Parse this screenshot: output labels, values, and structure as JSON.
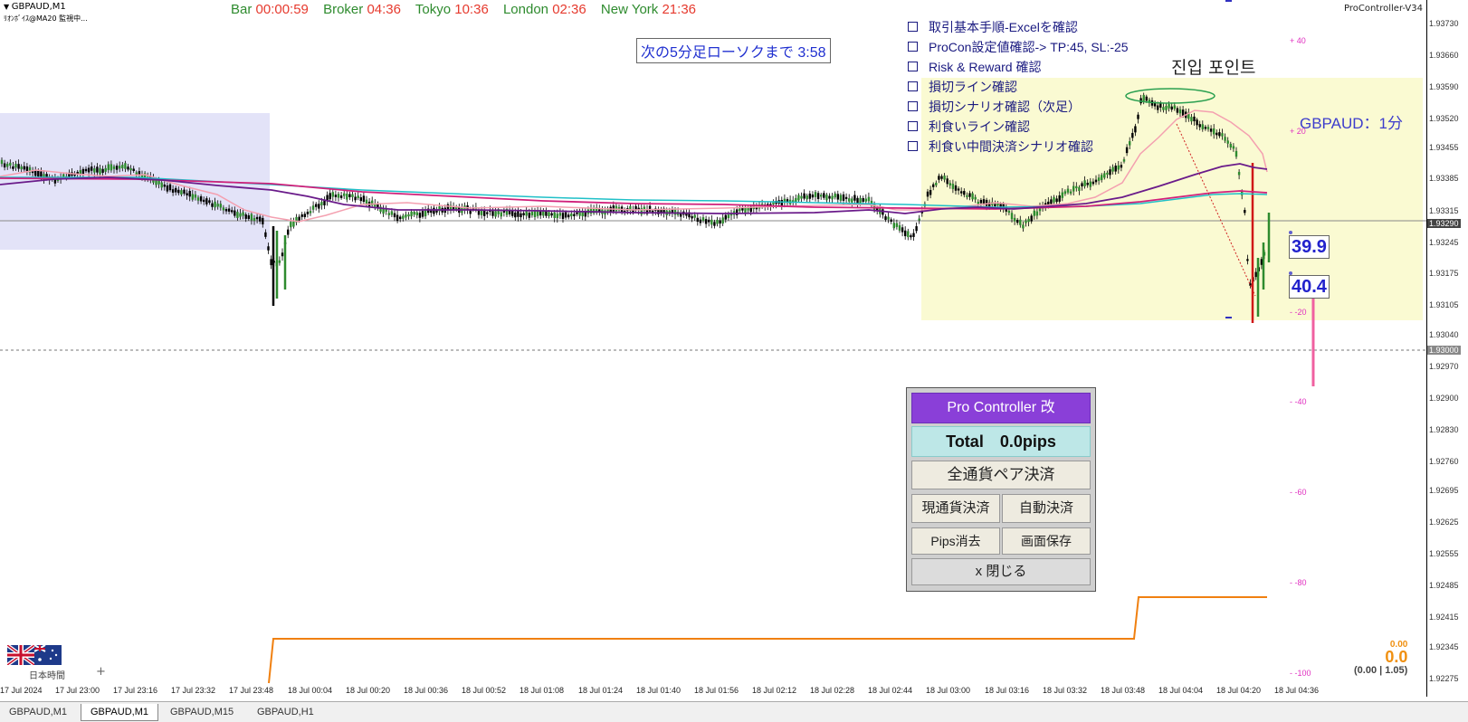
{
  "header": {
    "symbol_tf": "GBPAUD,M1",
    "indicator_sub": "ﾘｵﾝﾎﾞｲｽ@MA20 監視中...",
    "version": "ProController-V34"
  },
  "clocks": [
    {
      "label": "Bar",
      "value": "00:00:59"
    },
    {
      "label": "Broker",
      "value": "04:36"
    },
    {
      "label": "Tokyo",
      "value": "10:36"
    },
    {
      "label": "London",
      "value": "02:36"
    },
    {
      "label": "New York",
      "value": "21:36"
    }
  ],
  "countdown": "次の5分足ローソクまで 3:58",
  "checklist": [
    "取引基本手順-Excelを確認",
    "ProCon設定値確認-> TP:45, SL:-25",
    "Risk & Reward 確認",
    "損切ライン確認",
    "損切シナリオ確認（次足）",
    "利食いライン確認",
    "利食い中間決済シナリオ確認"
  ],
  "entry_label": "진입 포인트",
  "pair_label": "GBPAUD：1分",
  "pips_boxes": {
    "upper": "39.9",
    "lower": "40.4"
  },
  "pink_scale": [
    "40",
    "20",
    "-20",
    "-40",
    "-60",
    "-80",
    "-100"
  ],
  "price_axis": [
    "1.93730",
    "1.93660",
    "1.93590",
    "1.93520",
    "1.93455",
    "1.93385",
    "1.93315",
    "1.93245",
    "1.93175",
    "1.93105",
    "1.93040",
    "1.92970",
    "1.92900",
    "1.92830",
    "1.92760",
    "1.92695",
    "1.92625",
    "1.92555",
    "1.92485",
    "1.92415",
    "1.92345",
    "1.92275"
  ],
  "price_current": "1.93290",
  "price_level": "1.93000",
  "time_axis": [
    "17 Jul 2024",
    "17 Jul 23:00",
    "17 Jul 23:16",
    "17 Jul 23:32",
    "17 Jul 23:48",
    "18 Jul 00:04",
    "18 Jul 00:20",
    "18 Jul 00:36",
    "18 Jul 00:52",
    "18 Jul 01:08",
    "18 Jul 01:24",
    "18 Jul 01:40",
    "18 Jul 01:56",
    "18 Jul 02:12",
    "18 Jul 02:28",
    "18 Jul 02:44",
    "18 Jul 03:00",
    "18 Jul 03:16",
    "18 Jul 03:32",
    "18 Jul 03:48",
    "18 Jul 04:04",
    "18 Jul 04:20",
    "18 Jul 04:36"
  ],
  "panel": {
    "title": "Pro Controller 改",
    "total": "Total　0.0pips",
    "close_all": "全通貨ペア決済",
    "close_current": "現通貨決済",
    "auto_close": "自動決済",
    "pips_clear": "Pips消去",
    "save_screen": "画面保存",
    "close_panel": "x 閉じる"
  },
  "orange_values": {
    "small": "0.00",
    "big": "0.0",
    "detail": "(0.00 | 1.05)"
  },
  "timezone_label": "日本時間",
  "tabs": [
    "GBPAUD,M1",
    "GBPAUD,M1",
    "GBPAUD,M15",
    "GBPAUD,H1"
  ],
  "colors": {
    "clock_label": "#2e8b2e",
    "clock_value": "#e63a2e",
    "ma_purple": "#6a1b8a",
    "ma_magenta": "#d0207a",
    "ma_cyan": "#20c0c8",
    "ma_pink": "#f4a0b0",
    "orange_line": "#f08010",
    "yellow_zone": "#fafad2",
    "blue_zone": "#e3e3f8"
  }
}
